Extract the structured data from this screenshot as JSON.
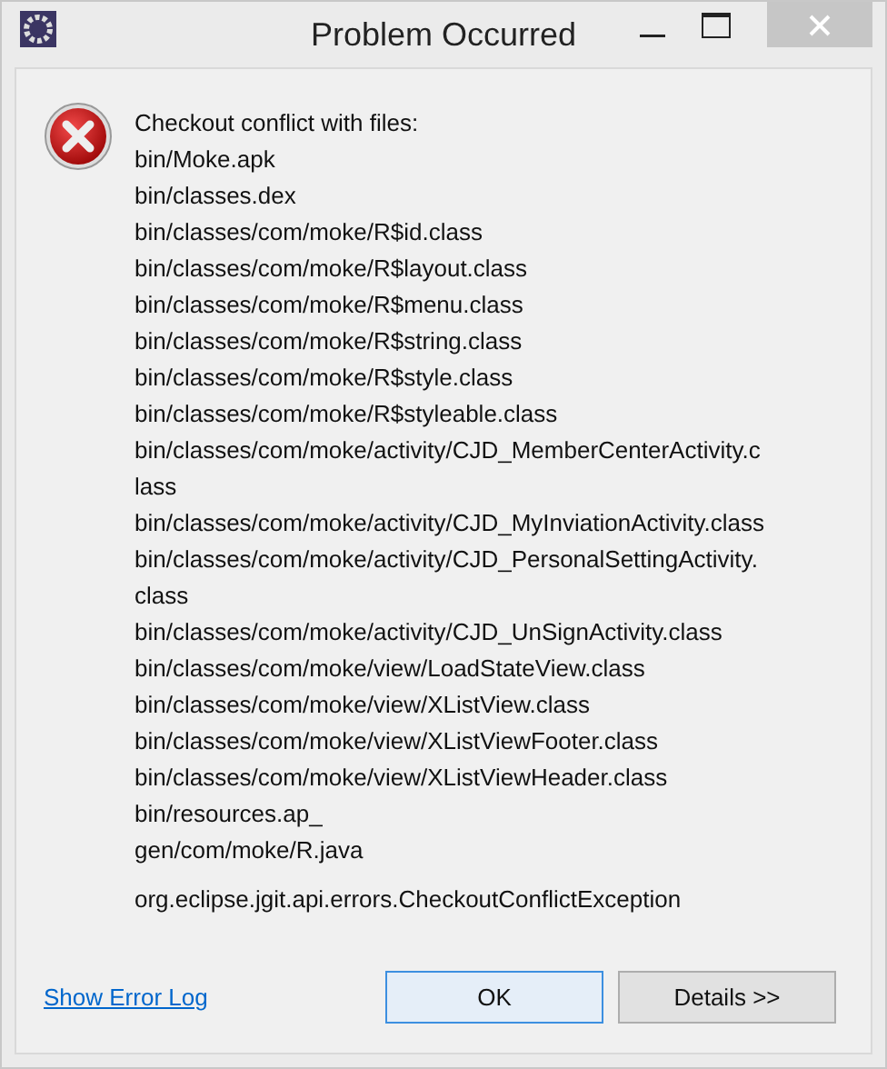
{
  "window": {
    "title": "Problem Occurred"
  },
  "message": {
    "heading": "Checkout conflict with files:",
    "lines": [
      "bin/Moke.apk",
      "bin/classes.dex",
      "bin/classes/com/moke/R$id.class",
      "bin/classes/com/moke/R$layout.class",
      "bin/classes/com/moke/R$menu.class",
      "bin/classes/com/moke/R$string.class",
      "bin/classes/com/moke/R$style.class",
      "bin/classes/com/moke/R$styleable.class",
      "bin/classes/com/moke/activity/CJD_MemberCenterActivity.c",
      "lass",
      "bin/classes/com/moke/activity/CJD_MyInviationActivity.class",
      "bin/classes/com/moke/activity/CJD_PersonalSettingActivity.",
      "class",
      "bin/classes/com/moke/activity/CJD_UnSignActivity.class",
      "bin/classes/com/moke/view/LoadStateView.class",
      "bin/classes/com/moke/view/XListView.class",
      "bin/classes/com/moke/view/XListViewFooter.class",
      "bin/classes/com/moke/view/XListViewHeader.class",
      "bin/resources.ap_",
      "gen/com/moke/R.java"
    ],
    "exception": "org.eclipse.jgit.api.errors.CheckoutConflictException"
  },
  "link": "Show Error Log",
  "buttons": [
    {
      "label": "OK",
      "selected": true
    },
    {
      "label": "Details >>",
      "selected": false
    }
  ]
}
